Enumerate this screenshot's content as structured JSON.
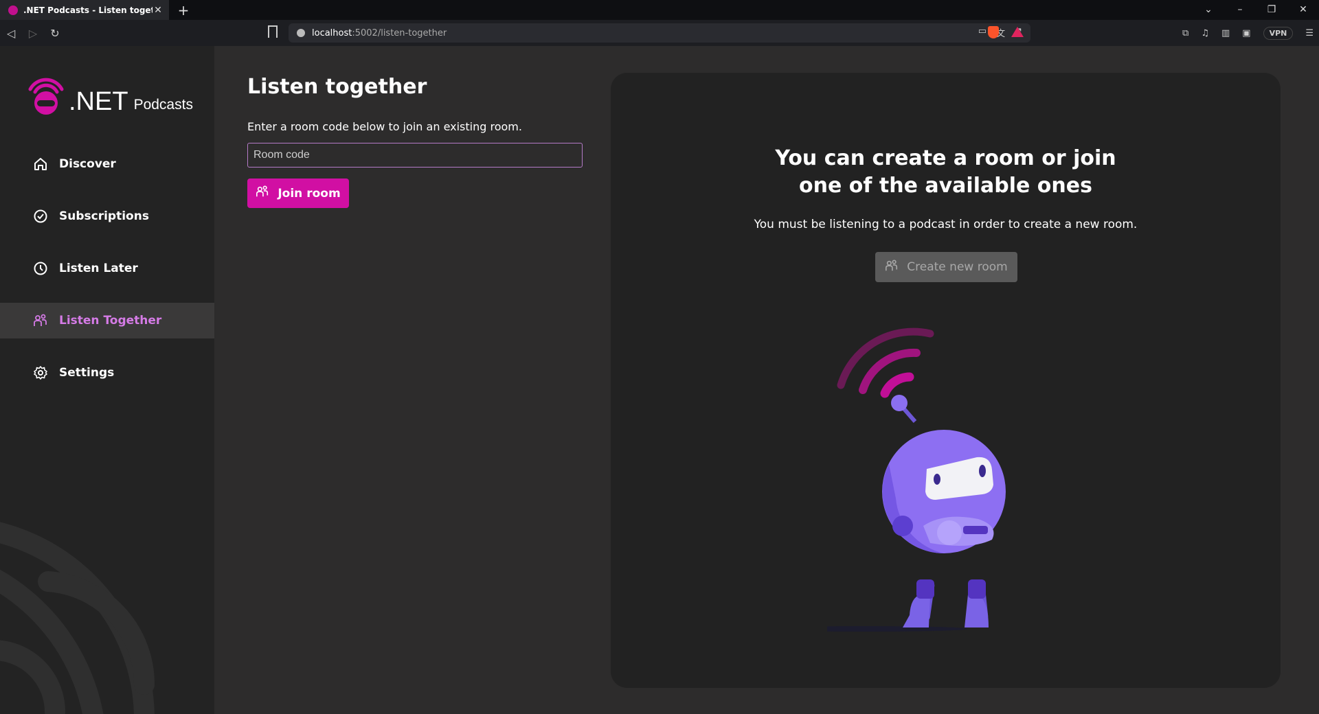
{
  "browser": {
    "tab_title": ".NET Podcasts - Listen together",
    "url_host": "localhost",
    "url_path": ":5002/listen-together",
    "vpn_label": "VPN"
  },
  "sidebar": {
    "logo_main": ".NET",
    "logo_sub": "Podcasts",
    "items": [
      {
        "label": "Discover",
        "icon": "home-icon"
      },
      {
        "label": "Subscriptions",
        "icon": "check-circle-icon"
      },
      {
        "label": "Listen Later",
        "icon": "clock-icon"
      },
      {
        "label": "Listen Together",
        "icon": "people-icon",
        "active": true
      },
      {
        "label": "Settings",
        "icon": "gear-icon"
      }
    ]
  },
  "main": {
    "title": "Listen together",
    "description": "Enter a room code below to join an existing room.",
    "room_code_placeholder": "Room code",
    "join_label": "Join room"
  },
  "panel": {
    "title_line1": "You can create a room or join",
    "title_line2": "one of the available ones",
    "text": "You must be listening to a podcast in order to create a new room.",
    "create_label": "Create new room"
  },
  "colors": {
    "accent": "#d10fa3",
    "active_nav": "#d57be6",
    "sidebar_bg": "#232323",
    "main_bg": "#2d2c2c",
    "panel_bg": "#222222"
  }
}
